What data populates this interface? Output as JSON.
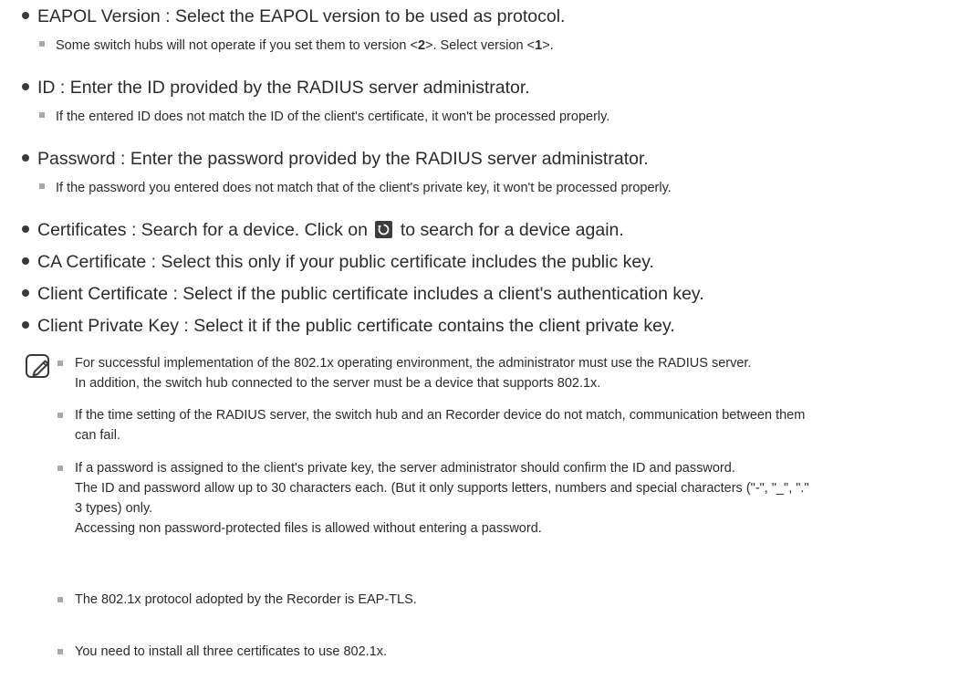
{
  "items": [
    {
      "label": "EAPOL Version : Select the EAPOL version to be used as protocol."
    },
    {
      "label": "ID : Enter the ID provided by the RADIUS server administrator."
    },
    {
      "label": "Password : Enter the password provided by the RADIUS server administrator."
    },
    {
      "label_before": "Certificates : Search for a device. Click on",
      "label_after": "to search for a device again."
    },
    {
      "label": "CA Certificate : Select this only if your public certificate includes the public key."
    },
    {
      "label": "Client Certificate : Select if the public certificate includes a client's authentication key."
    },
    {
      "label": "Client Private Key : Select it if the public certificate contains the client private key."
    }
  ],
  "subs": {
    "eapol": {
      "t1": "Some switch hubs will not operate if you set them to version <",
      "b1": "2",
      "t2": ">. Select version <",
      "b2": "1",
      "t3": ">."
    },
    "id": "If the entered ID does not match the ID of the client's certificate, it won't be processed properly.",
    "password": "If the password you entered does not match that of the client's private key, it won't be processed properly."
  },
  "icons": {
    "refresh": "refresh-icon",
    "note": "note-pencil-icon"
  },
  "notes": [
    {
      "lines": [
        "For successful implementation of the 802.1x operating environment, the administrator must use the RADIUS server.",
        "In addition, the switch hub connected to the server must be a device that supports 802.1x."
      ]
    },
    {
      "lines": [
        "If the time setting of the RADIUS server, the switch hub and an Recorder device do not match, communication between them",
        "can fail."
      ]
    },
    {
      "lines": [
        "If a password is assigned to the client's private key, the server administrator should confirm the ID and password.",
        "The ID and password allow up to 30 characters each. (But it only supports letters, numbers and special characters (\"-\", \"_\", \".\"",
        "3 types) only.",
        "Accessing non password-protected files is allowed without entering a password."
      ]
    },
    {
      "lines": [
        "The 802.1x protocol adopted by the Recorder is EAP-TLS."
      ]
    },
    {
      "lines": [
        "You need to install all three certificates to use 802.1x."
      ]
    }
  ]
}
